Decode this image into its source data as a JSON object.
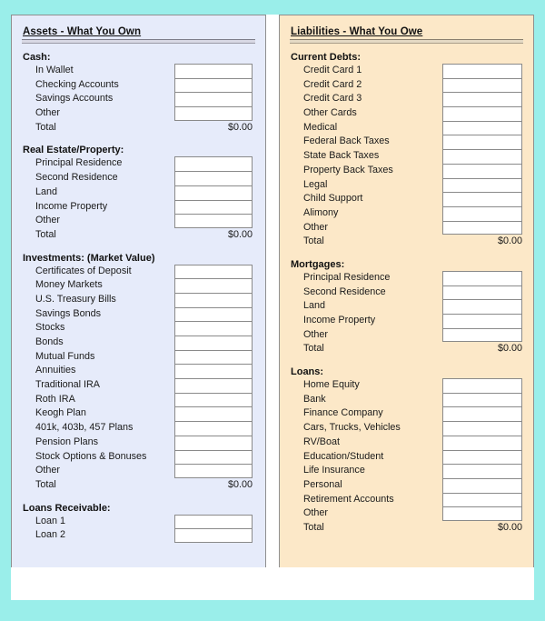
{
  "page": {
    "background_color": "#9aeeea",
    "sheet_color": "#ffffff"
  },
  "panels": [
    {
      "id": "assets",
      "title": "Assets - What You Own",
      "background_color": "#e6ebfa",
      "groups": [
        {
          "title": "Cash:",
          "items": [
            "In Wallet",
            "Checking Accounts",
            "Savings Accounts",
            "Other"
          ],
          "total_label": "Total",
          "total_value": "$0.00"
        },
        {
          "title": "Real Estate/Property:",
          "items": [
            "Principal Residence",
            "Second Residence",
            "Land",
            "Income Property",
            "Other"
          ],
          "total_label": "Total",
          "total_value": "$0.00"
        },
        {
          "title": "Investments: (Market Value)",
          "items": [
            "Certificates of Deposit",
            "Money Markets",
            "U.S. Treasury Bills",
            "Savings Bonds",
            "Stocks",
            "Bonds",
            "Mutual Funds",
            "Annuities",
            "Traditional IRA",
            "Roth IRA",
            "Keogh Plan",
            "401k, 403b, 457 Plans",
            "Pension Plans",
            "Stock Options & Bonuses",
            "Other"
          ],
          "total_label": "Total",
          "total_value": "$0.00"
        },
        {
          "title": "Loans Receivable:",
          "items": [
            "Loan 1",
            "Loan 2"
          ],
          "total_label": null,
          "total_value": null
        }
      ]
    },
    {
      "id": "liabilities",
      "title": "Liabilities - What You Owe",
      "background_color": "#fce8c8",
      "groups": [
        {
          "title": "Current Debts:",
          "items": [
            "Credit Card 1",
            "Credit Card 2",
            "Credit Card 3",
            "Other Cards",
            "Medical",
            "Federal Back Taxes",
            "State Back Taxes",
            "Property Back Taxes",
            "Legal",
            "Child Support",
            "Alimony",
            "Other"
          ],
          "total_label": "Total",
          "total_value": "$0.00"
        },
        {
          "title": "Mortgages:",
          "items": [
            "Principal Residence",
            "Second Residence",
            "Land",
            "Income Property",
            "Other"
          ],
          "total_label": "Total",
          "total_value": "$0.00"
        },
        {
          "title": "Loans:",
          "items": [
            "Home Equity",
            "Bank",
            "Finance Company",
            "Cars, Trucks, Vehicles",
            "RV/Boat",
            "Education/Student",
            "Life Insurance",
            "Personal",
            "Retirement Accounts",
            "Other"
          ],
          "total_label": "Total",
          "total_value": "$0.00"
        }
      ]
    }
  ]
}
